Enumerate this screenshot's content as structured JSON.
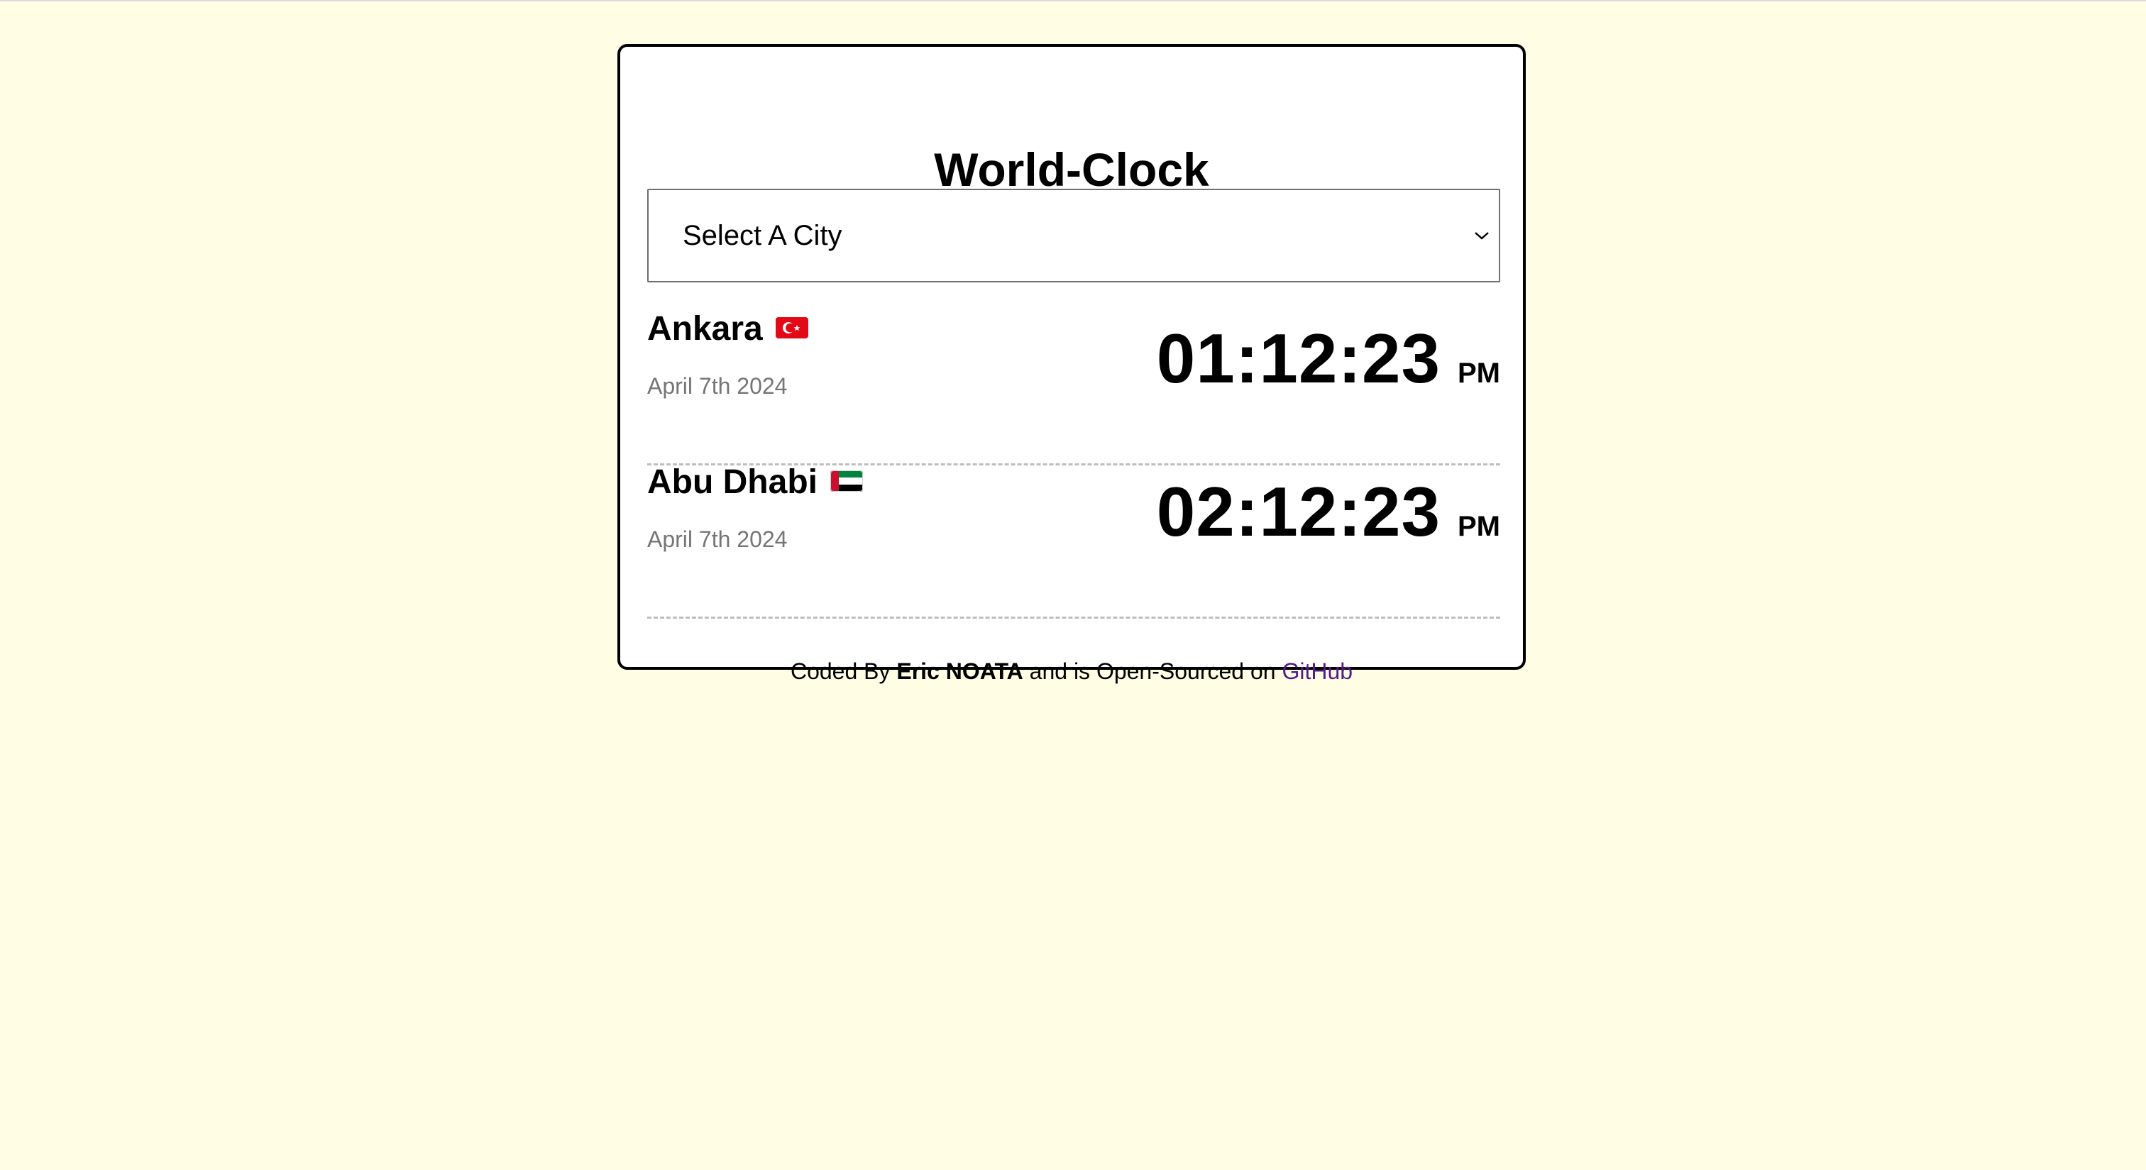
{
  "app": {
    "title": "World-Clock"
  },
  "city_select": {
    "selected_label": "Select A City",
    "arrow_icon": "chevron-down-icon"
  },
  "cities": [
    {
      "name": "Ankara",
      "flag": "turkey-flag-icon",
      "date": "April 7th 2024",
      "time": "01:12:23",
      "period": "PM"
    },
    {
      "name": "Abu Dhabi",
      "flag": "uae-flag-icon",
      "date": "April 7th 2024",
      "time": "02:12:23",
      "period": "PM"
    }
  ],
  "footer": {
    "prefix": "Coded By",
    "author": "Eric NOATA",
    "middle": "and is Open-Sourced on",
    "link_label": "GitHub"
  },
  "colors": {
    "page_background": "#fffee4",
    "card_background": "#ffffff",
    "date_text": "#757575",
    "link": "#551a8b",
    "divider": "#bdbdbd"
  }
}
